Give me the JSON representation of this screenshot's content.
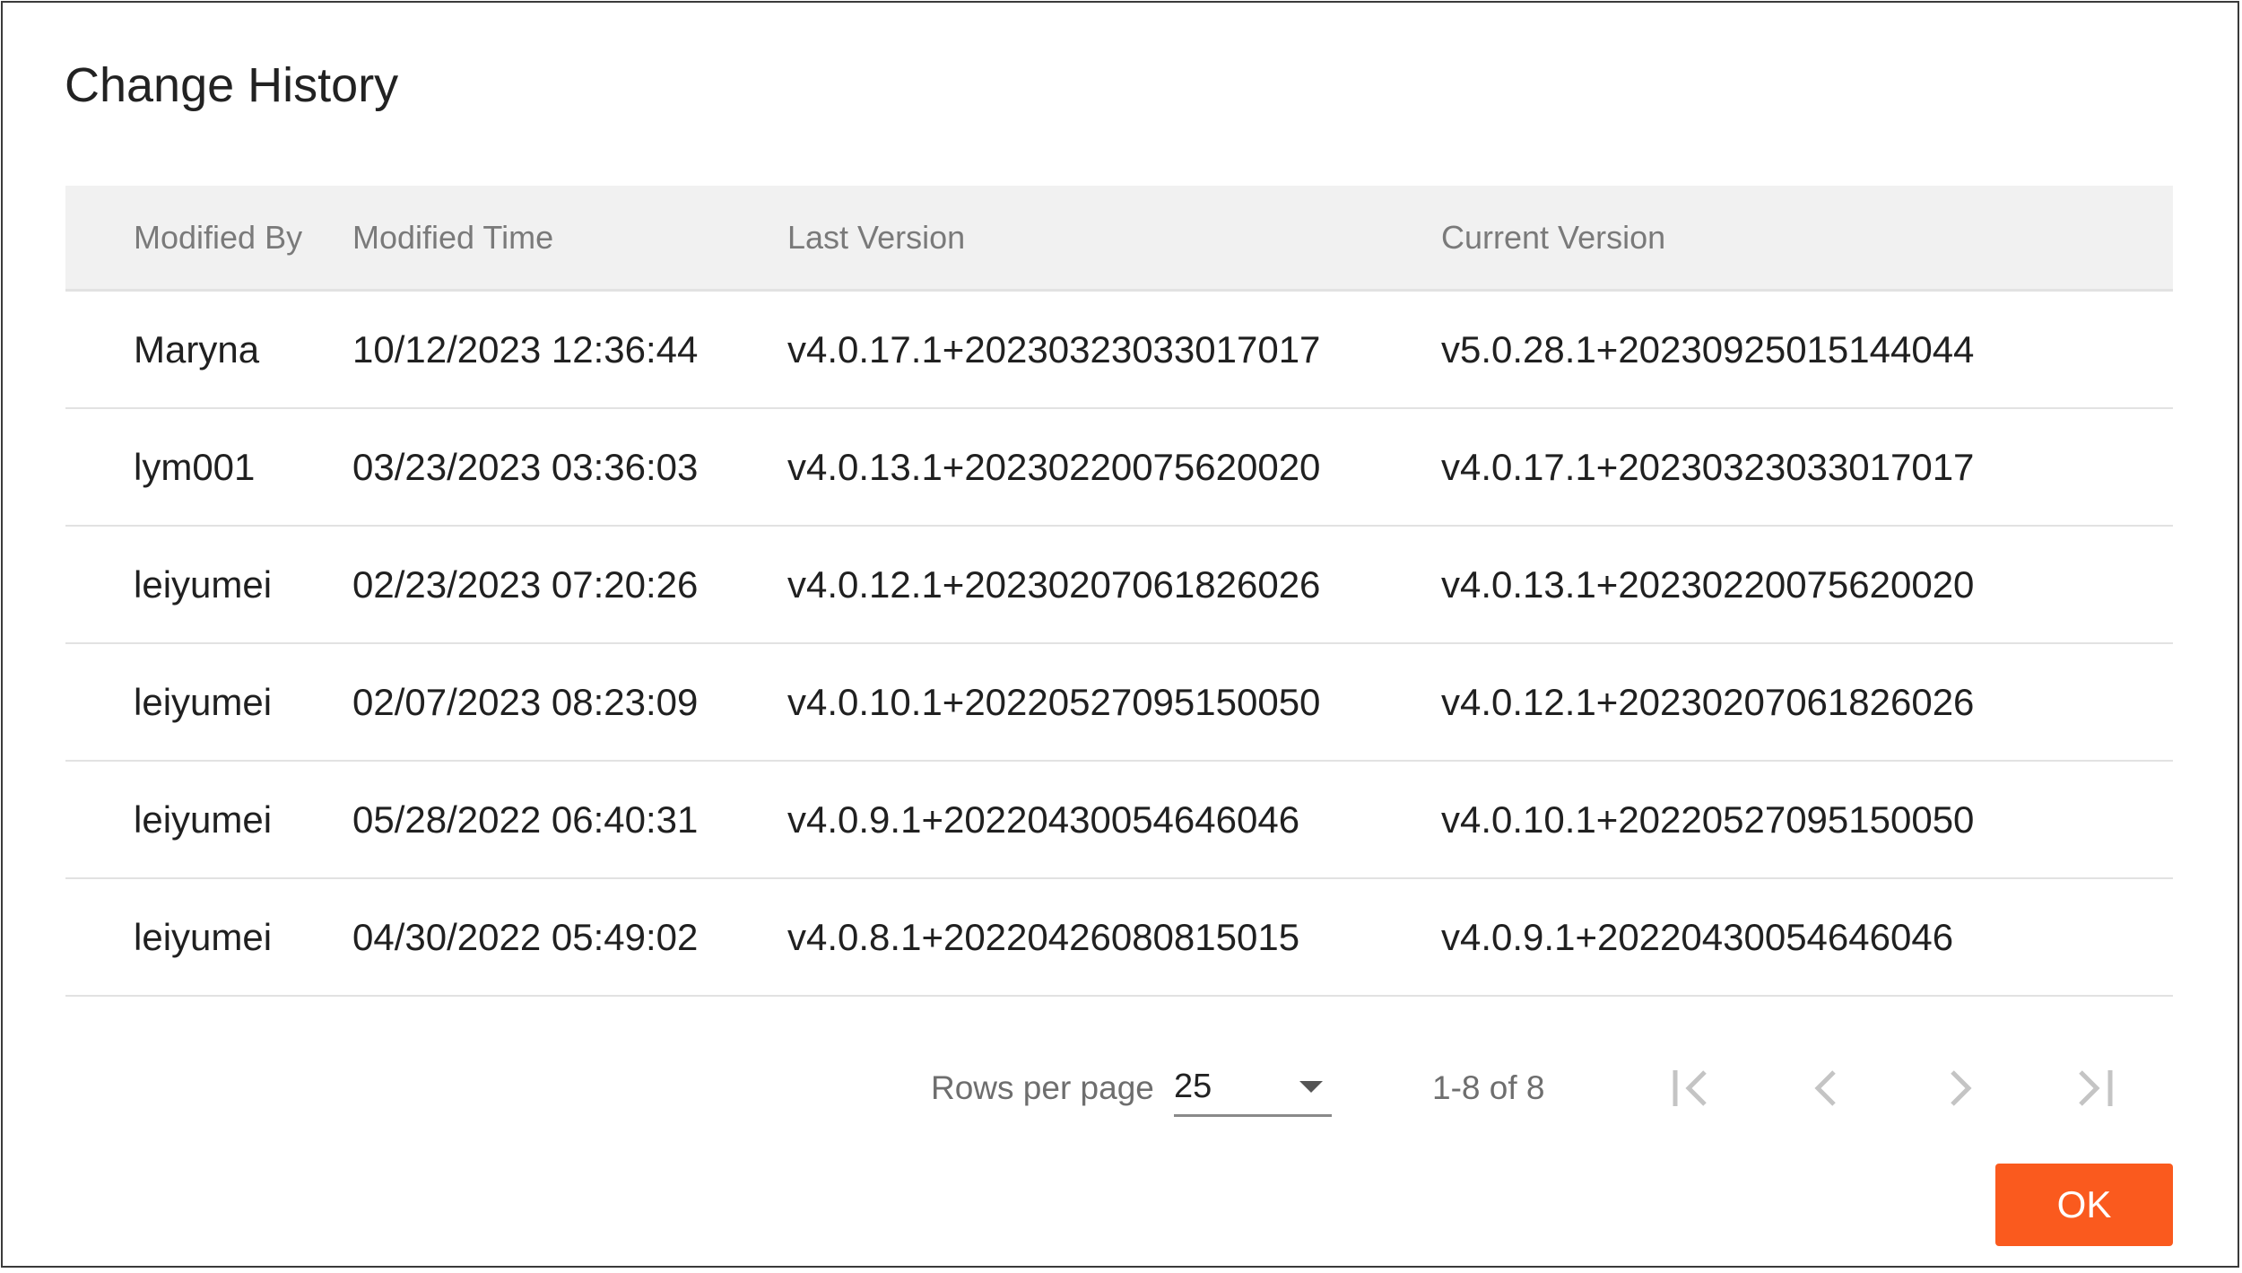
{
  "dialog": {
    "title": "Change History"
  },
  "table": {
    "columns": [
      "Modified By",
      "Modified Time",
      "Last Version",
      "Current Version"
    ],
    "rows": [
      [
        "Maryna",
        "10/12/2023 12:36:44",
        "v4.0.17.1+20230323033017017",
        "v5.0.28.1+20230925015144044"
      ],
      [
        "lym001",
        "03/23/2023 03:36:03",
        "v4.0.13.1+20230220075620020",
        "v4.0.17.1+20230323033017017"
      ],
      [
        "leiyumei",
        "02/23/2023 07:20:26",
        "v4.0.12.1+20230207061826026",
        "v4.0.13.1+20230220075620020"
      ],
      [
        "leiyumei",
        "02/07/2023 08:23:09",
        "v4.0.10.1+20220527095150050",
        "v4.0.12.1+20230207061826026"
      ],
      [
        "leiyumei",
        "05/28/2022 06:40:31",
        "v4.0.9.1+20220430054646046",
        "v4.0.10.1+20220527095150050"
      ],
      [
        "leiyumei",
        "04/30/2022 05:49:02",
        "v4.0.8.1+20220426080815015",
        "v4.0.9.1+20220430054646046"
      ]
    ]
  },
  "pagination": {
    "rows_per_page_label": "Rows per page",
    "rows_per_page_value": "25",
    "range_text": "1-8 of 8",
    "icons": [
      "first-page-icon",
      "previous-page-icon",
      "next-page-icon",
      "last-page-icon"
    ]
  },
  "footer": {
    "ok_label": "OK"
  },
  "colors": {
    "accent": "#fa5a1e",
    "header_bg": "#f1f1f1",
    "disabled_icon": "#c4c4c4"
  }
}
